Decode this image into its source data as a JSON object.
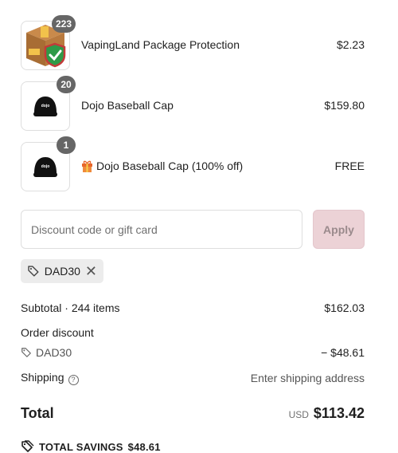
{
  "items": [
    {
      "name": "VapingLand Package Protection",
      "price": "$2.23",
      "qty": "223",
      "thumb": "package-protection-icon"
    },
    {
      "name": "Dojo Baseball Cap",
      "price": "$159.80",
      "qty": "20",
      "thumb": "cap-icon"
    },
    {
      "name": "Dojo Baseball Cap (100% off)",
      "price": "FREE",
      "qty": "1",
      "thumb": "cap-icon",
      "badge": "gift-icon"
    }
  ],
  "discount": {
    "placeholder": "Discount code or gift card",
    "apply_label": "Apply",
    "applied_code": "DAD30"
  },
  "summary": {
    "subtotal_label": "Subtotal · 244 items",
    "subtotal_value": "$162.03",
    "order_discount_label": "Order discount",
    "discount_code": "DAD30",
    "discount_value": "− $48.61",
    "shipping_label": "Shipping",
    "shipping_value": "Enter shipping address",
    "total_label": "Total",
    "currency": "USD",
    "total_value": "$113.42",
    "savings_label": "TOTAL SAVINGS",
    "savings_value": "$48.61"
  },
  "colors": {
    "apply_bg": "#ecd2d6",
    "qty_badge": "#666666"
  }
}
